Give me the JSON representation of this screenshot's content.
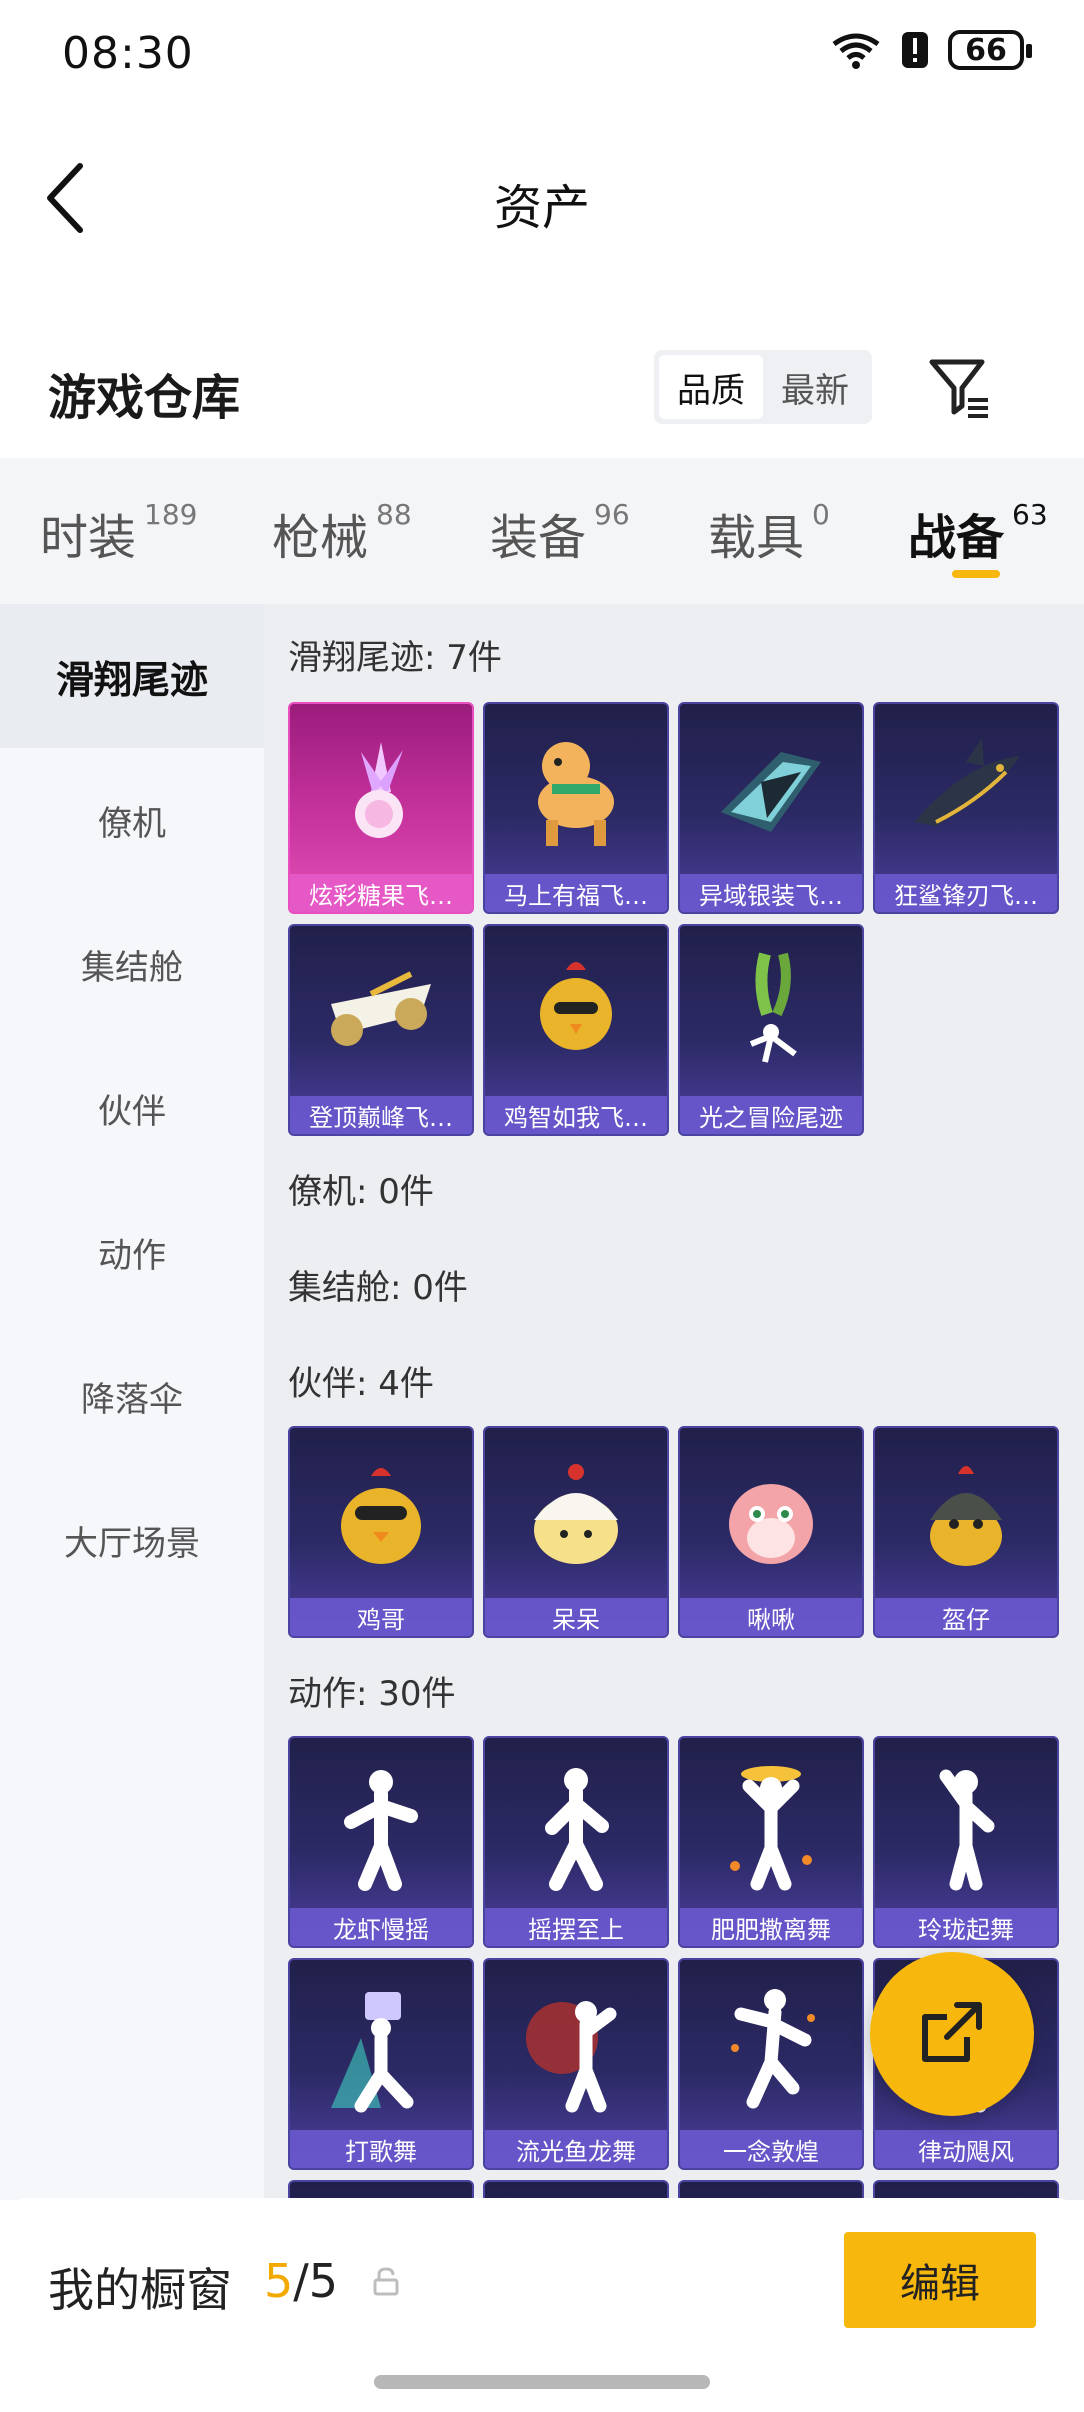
{
  "status_bar": {
    "time": "08:30",
    "battery": "66"
  },
  "header": {
    "title": "资产"
  },
  "warehouse": {
    "title": "游戏仓库",
    "sort_options": [
      "品质",
      "最新"
    ],
    "active_sort": "品质"
  },
  "tabs": [
    {
      "label": "时装",
      "count": "189"
    },
    {
      "label": "枪械",
      "count": "88"
    },
    {
      "label": "装备",
      "count": "96"
    },
    {
      "label": "载具",
      "count": "0"
    },
    {
      "label": "战备",
      "count": "63"
    }
  ],
  "active_tab": "战备",
  "sidebar": {
    "items": [
      "滑翔尾迹",
      "僚机",
      "集结舱",
      "伙伴",
      "动作",
      "降落伞",
      "大厅场景"
    ],
    "active": "滑翔尾迹"
  },
  "sections": {
    "trails": {
      "title": "滑翔尾迹: 7件",
      "items": [
        "炫彩糖果飞…",
        "马上有福飞…",
        "异域银装飞…",
        "狂鲨锋刃飞…",
        "登顶巅峰飞…",
        "鸡智如我飞…",
        "光之冒险尾迹"
      ]
    },
    "wingman": {
      "title": "僚机: 0件"
    },
    "capsule": {
      "title": "集结舱: 0件"
    },
    "partners": {
      "title": "伙伴: 4件",
      "items": [
        "鸡哥",
        "呆呆",
        "啾啾",
        "盔仔"
      ]
    },
    "emotes": {
      "title": "动作: 30件",
      "items": [
        "龙虾慢摇",
        "摇摆至上",
        "肥肥撒离舞",
        "玲珑起舞",
        "打歌舞",
        "流光鱼龙舞",
        "一念敦煌",
        "律动飓风"
      ]
    }
  },
  "showcase": {
    "label": "我的橱窗",
    "used": "5",
    "separator": "/",
    "total": "5"
  },
  "edit_label": "编辑",
  "colors": {
    "accent": "#f7b70c",
    "card_purple": "#2c2a66",
    "card_pink": "#c8349e"
  }
}
